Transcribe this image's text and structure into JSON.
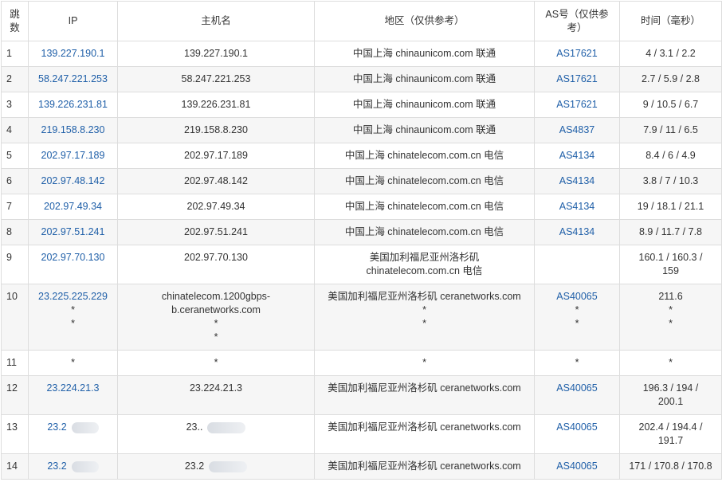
{
  "headers": {
    "hop": [
      "跳",
      "数"
    ],
    "ip": "IP",
    "host": "主机名",
    "region": "地区（仅供参考）",
    "asn": [
      "AS号（仅供参",
      "考）"
    ],
    "time": "时间（毫秒）"
  },
  "rows": [
    {
      "hop": "1",
      "ip": [
        "139.227.190.1"
      ],
      "host": [
        "139.227.190.1"
      ],
      "region": [
        "中国上海 chinaunicom.com 联通"
      ],
      "asn": [
        "AS17621"
      ],
      "time": [
        "4 / 3.1 / 2.2"
      ]
    },
    {
      "hop": "2",
      "ip": [
        "58.247.221.253"
      ],
      "host": [
        "58.247.221.253"
      ],
      "region": [
        "中国上海 chinaunicom.com 联通"
      ],
      "asn": [
        "AS17621"
      ],
      "time": [
        "2.7 / 5.9 / 2.8"
      ]
    },
    {
      "hop": "3",
      "ip": [
        "139.226.231.81"
      ],
      "host": [
        "139.226.231.81"
      ],
      "region": [
        "中国上海 chinaunicom.com 联通"
      ],
      "asn": [
        "AS17621"
      ],
      "time": [
        "9 / 10.5 / 6.7"
      ]
    },
    {
      "hop": "4",
      "ip": [
        "219.158.8.230"
      ],
      "host": [
        "219.158.8.230"
      ],
      "region": [
        "中国上海 chinaunicom.com 联通"
      ],
      "asn": [
        "AS4837"
      ],
      "time": [
        "7.9 / 11 / 6.5"
      ]
    },
    {
      "hop": "5",
      "ip": [
        "202.97.17.189"
      ],
      "host": [
        "202.97.17.189"
      ],
      "region": [
        "中国上海 chinatelecom.com.cn 电信"
      ],
      "asn": [
        "AS4134"
      ],
      "time": [
        "8.4 / 6 / 4.9"
      ]
    },
    {
      "hop": "6",
      "ip": [
        "202.97.48.142"
      ],
      "host": [
        "202.97.48.142"
      ],
      "region": [
        "中国上海 chinatelecom.com.cn 电信"
      ],
      "asn": [
        "AS4134"
      ],
      "time": [
        "3.8 / 7 / 10.3"
      ]
    },
    {
      "hop": "7",
      "ip": [
        "202.97.49.34"
      ],
      "host": [
        "202.97.49.34"
      ],
      "region": [
        "中国上海 chinatelecom.com.cn 电信"
      ],
      "asn": [
        "AS4134"
      ],
      "time": [
        "19 / 18.1 / 21.1"
      ]
    },
    {
      "hop": "8",
      "ip": [
        "202.97.51.241"
      ],
      "host": [
        "202.97.51.241"
      ],
      "region": [
        "中国上海 chinatelecom.com.cn 电信"
      ],
      "asn": [
        "AS4134"
      ],
      "time": [
        "8.9 / 11.7 / 7.8"
      ]
    },
    {
      "hop": "9",
      "ip": [
        "202.97.70.130"
      ],
      "host": [
        "202.97.70.130"
      ],
      "region": [
        "美国加利福尼亚州洛杉矶",
        "chinatelecom.com.cn 电信"
      ],
      "asn": [],
      "time": [
        "160.1 / 160.3 /",
        "159"
      ]
    },
    {
      "hop": "10",
      "ip": [
        "23.225.225.229",
        "*",
        "*"
      ],
      "host": [
        "chinatelecom.1200gbps-",
        "b.ceranetworks.com",
        "*",
        "*"
      ],
      "region": [
        "美国加利福尼亚州洛杉矶 ceranetworks.com",
        "*",
        "*"
      ],
      "asn": [
        "AS40065",
        "*",
        "*"
      ],
      "time": [
        "211.6",
        "*",
        "*"
      ]
    },
    {
      "hop": "11",
      "ip": [
        "*"
      ],
      "host": [
        "*"
      ],
      "region": [
        "*"
      ],
      "asn": [
        "*"
      ],
      "time": [
        "*"
      ]
    },
    {
      "hop": "12",
      "ip": [
        "23.224.21.3"
      ],
      "host": [
        "23.224.21.3"
      ],
      "region": [
        "美国加利福尼亚州洛杉矶 ceranetworks.com"
      ],
      "asn": [
        "AS40065"
      ],
      "time": [
        "196.3 / 194 /",
        "200.1"
      ]
    },
    {
      "hop": "13",
      "ip": [
        "23.2"
      ],
      "host": [
        "23.."
      ],
      "region": [
        "美国加利福尼亚州洛杉矶 ceranetworks.com"
      ],
      "asn": [
        "AS40065"
      ],
      "time": [
        "202.4 / 194.4 /",
        "191.7"
      ]
    },
    {
      "hop": "14",
      "ip": [
        "23.2"
      ],
      "host": [
        "23.2"
      ],
      "region": [
        "美国加利福尼亚州洛杉矶 ceranetworks.com"
      ],
      "asn": [
        "AS40065"
      ],
      "time": [
        "171 / 170.8 / 170.8"
      ]
    }
  ]
}
